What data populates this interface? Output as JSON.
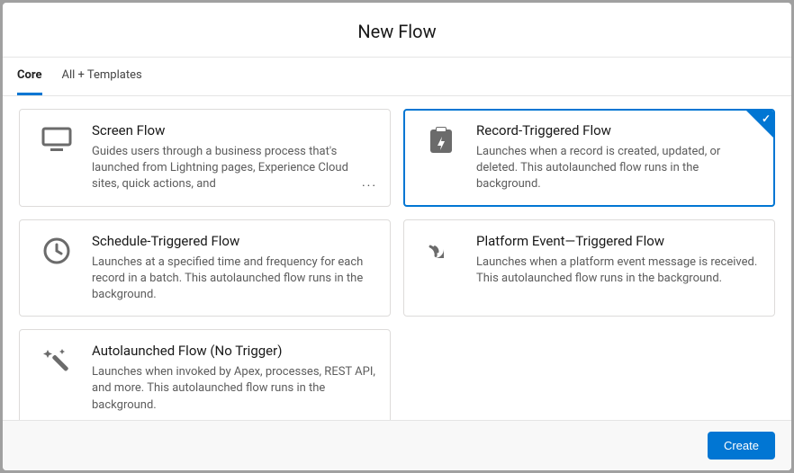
{
  "header": {
    "title": "New Flow"
  },
  "tabs": {
    "core": "Core",
    "templates": "All + Templates"
  },
  "cards": {
    "screen": {
      "title": "Screen Flow",
      "desc": "Guides users through a business process that's launched from Lightning pages, Experience Cloud sites, quick actions, and"
    },
    "record": {
      "title": "Record-Triggered Flow",
      "desc": "Launches when a record is created, updated, or deleted. This autolaunched flow runs in the background."
    },
    "schedule": {
      "title": "Schedule-Triggered Flow",
      "desc": "Launches at a specified time and frequency for each record in a batch. This autolaunched flow runs in the background."
    },
    "platform": {
      "title": "Platform Event—Triggered Flow",
      "desc": "Launches when a platform event message is received. This autolaunched flow runs in the background."
    },
    "auto": {
      "title": "Autolaunched Flow (No Trigger)",
      "desc": "Launches when invoked by Apex, processes, REST API, and more. This autolaunched flow runs in the background."
    }
  },
  "footer": {
    "create": "Create"
  }
}
